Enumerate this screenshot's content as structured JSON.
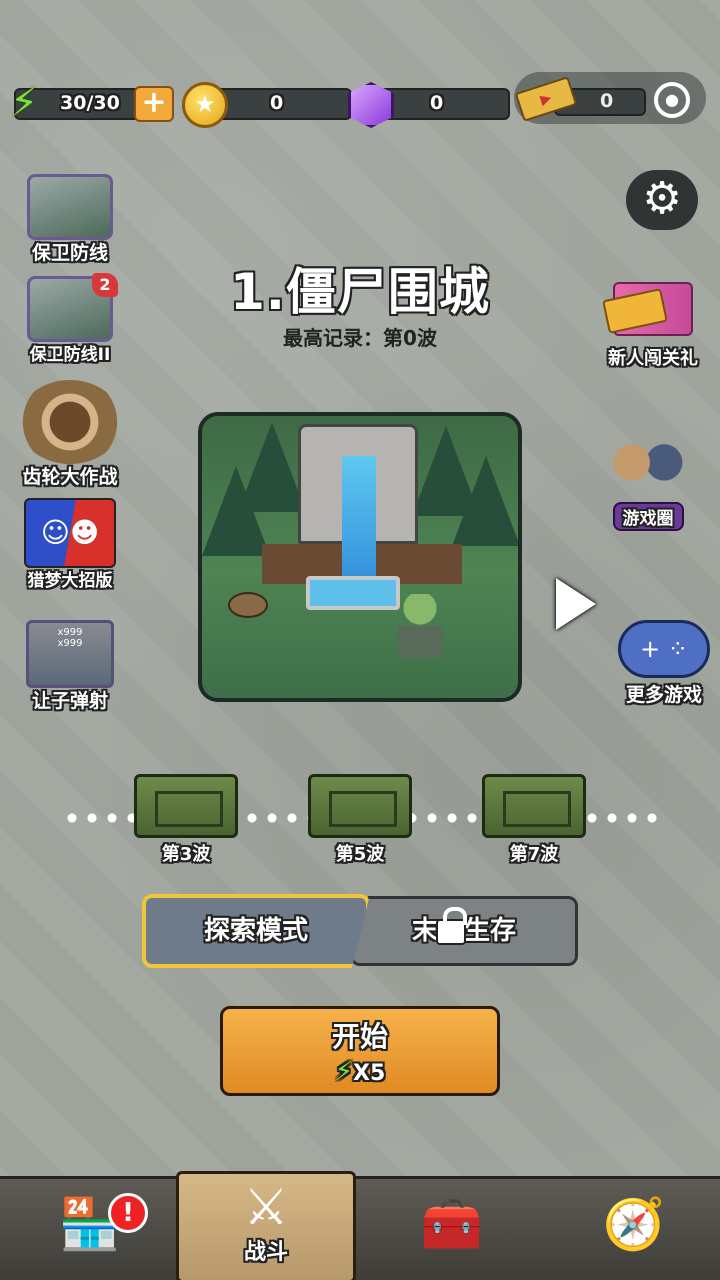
{
  "resources": {
    "energy": "30/30",
    "coins": "0",
    "gems": "0",
    "tickets": "0"
  },
  "left_games": [
    {
      "label": "保卫防线",
      "badge": ""
    },
    {
      "label": "保卫防线II",
      "badge": "2"
    },
    {
      "label": "齿轮大作战",
      "badge": ""
    },
    {
      "label": "猎梦大招版",
      "badge": ""
    },
    {
      "label": "让子弹射",
      "badge": ""
    }
  ],
  "cannon_text": [
    "x999",
    "x999"
  ],
  "level": {
    "title": "1.僵尸围城",
    "record": "最高记录：第0波"
  },
  "right_side": {
    "newbie_gift": "新人闯关礼",
    "game_circle": "游戏圈",
    "more_games": "更多游戏"
  },
  "wave_rewards": [
    "第3波",
    "第5波",
    "第7波"
  ],
  "modes": {
    "explore": "探索模式",
    "survival_left": "末",
    "survival_right": "生存"
  },
  "start": {
    "label": "开始",
    "cost": "X5"
  },
  "bottom_nav": {
    "battle": "战斗",
    "shop_alert": "!"
  },
  "colors": {
    "accent_orange": "#f2a93b",
    "energy_green": "#7ee03a",
    "selected_border": "#f2c537"
  }
}
